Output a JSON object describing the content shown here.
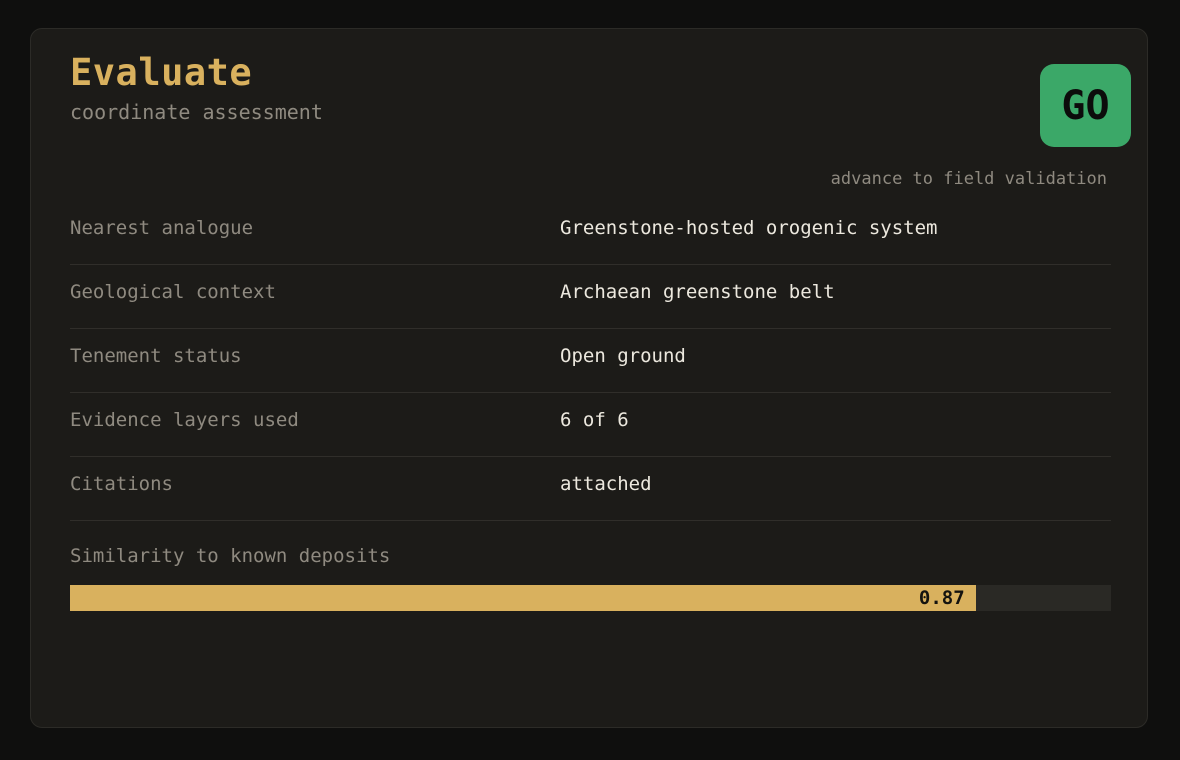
{
  "header": {
    "title": "Evaluate",
    "subtitle": "coordinate assessment"
  },
  "decision": {
    "badge_label": "GO",
    "badge_color": "#3ba868",
    "caption": "advance to field validation"
  },
  "rows": [
    {
      "label": "Nearest analogue",
      "value": "Greenstone-hosted orogenic system"
    },
    {
      "label": "Geological context",
      "value": "Archaean greenstone belt"
    },
    {
      "label": "Tenement status",
      "value": "Open ground"
    },
    {
      "label": "Evidence layers used",
      "value": "6 of 6"
    },
    {
      "label": "Citations",
      "value": "attached"
    }
  ],
  "similarity": {
    "label": "Similarity to known deposits",
    "value": 0.87,
    "value_text": "0.87",
    "bar_color": "#d9b15e"
  },
  "colors": {
    "accent": "#d9b15e",
    "go": "#3ba868",
    "background": "#1c1b18"
  }
}
